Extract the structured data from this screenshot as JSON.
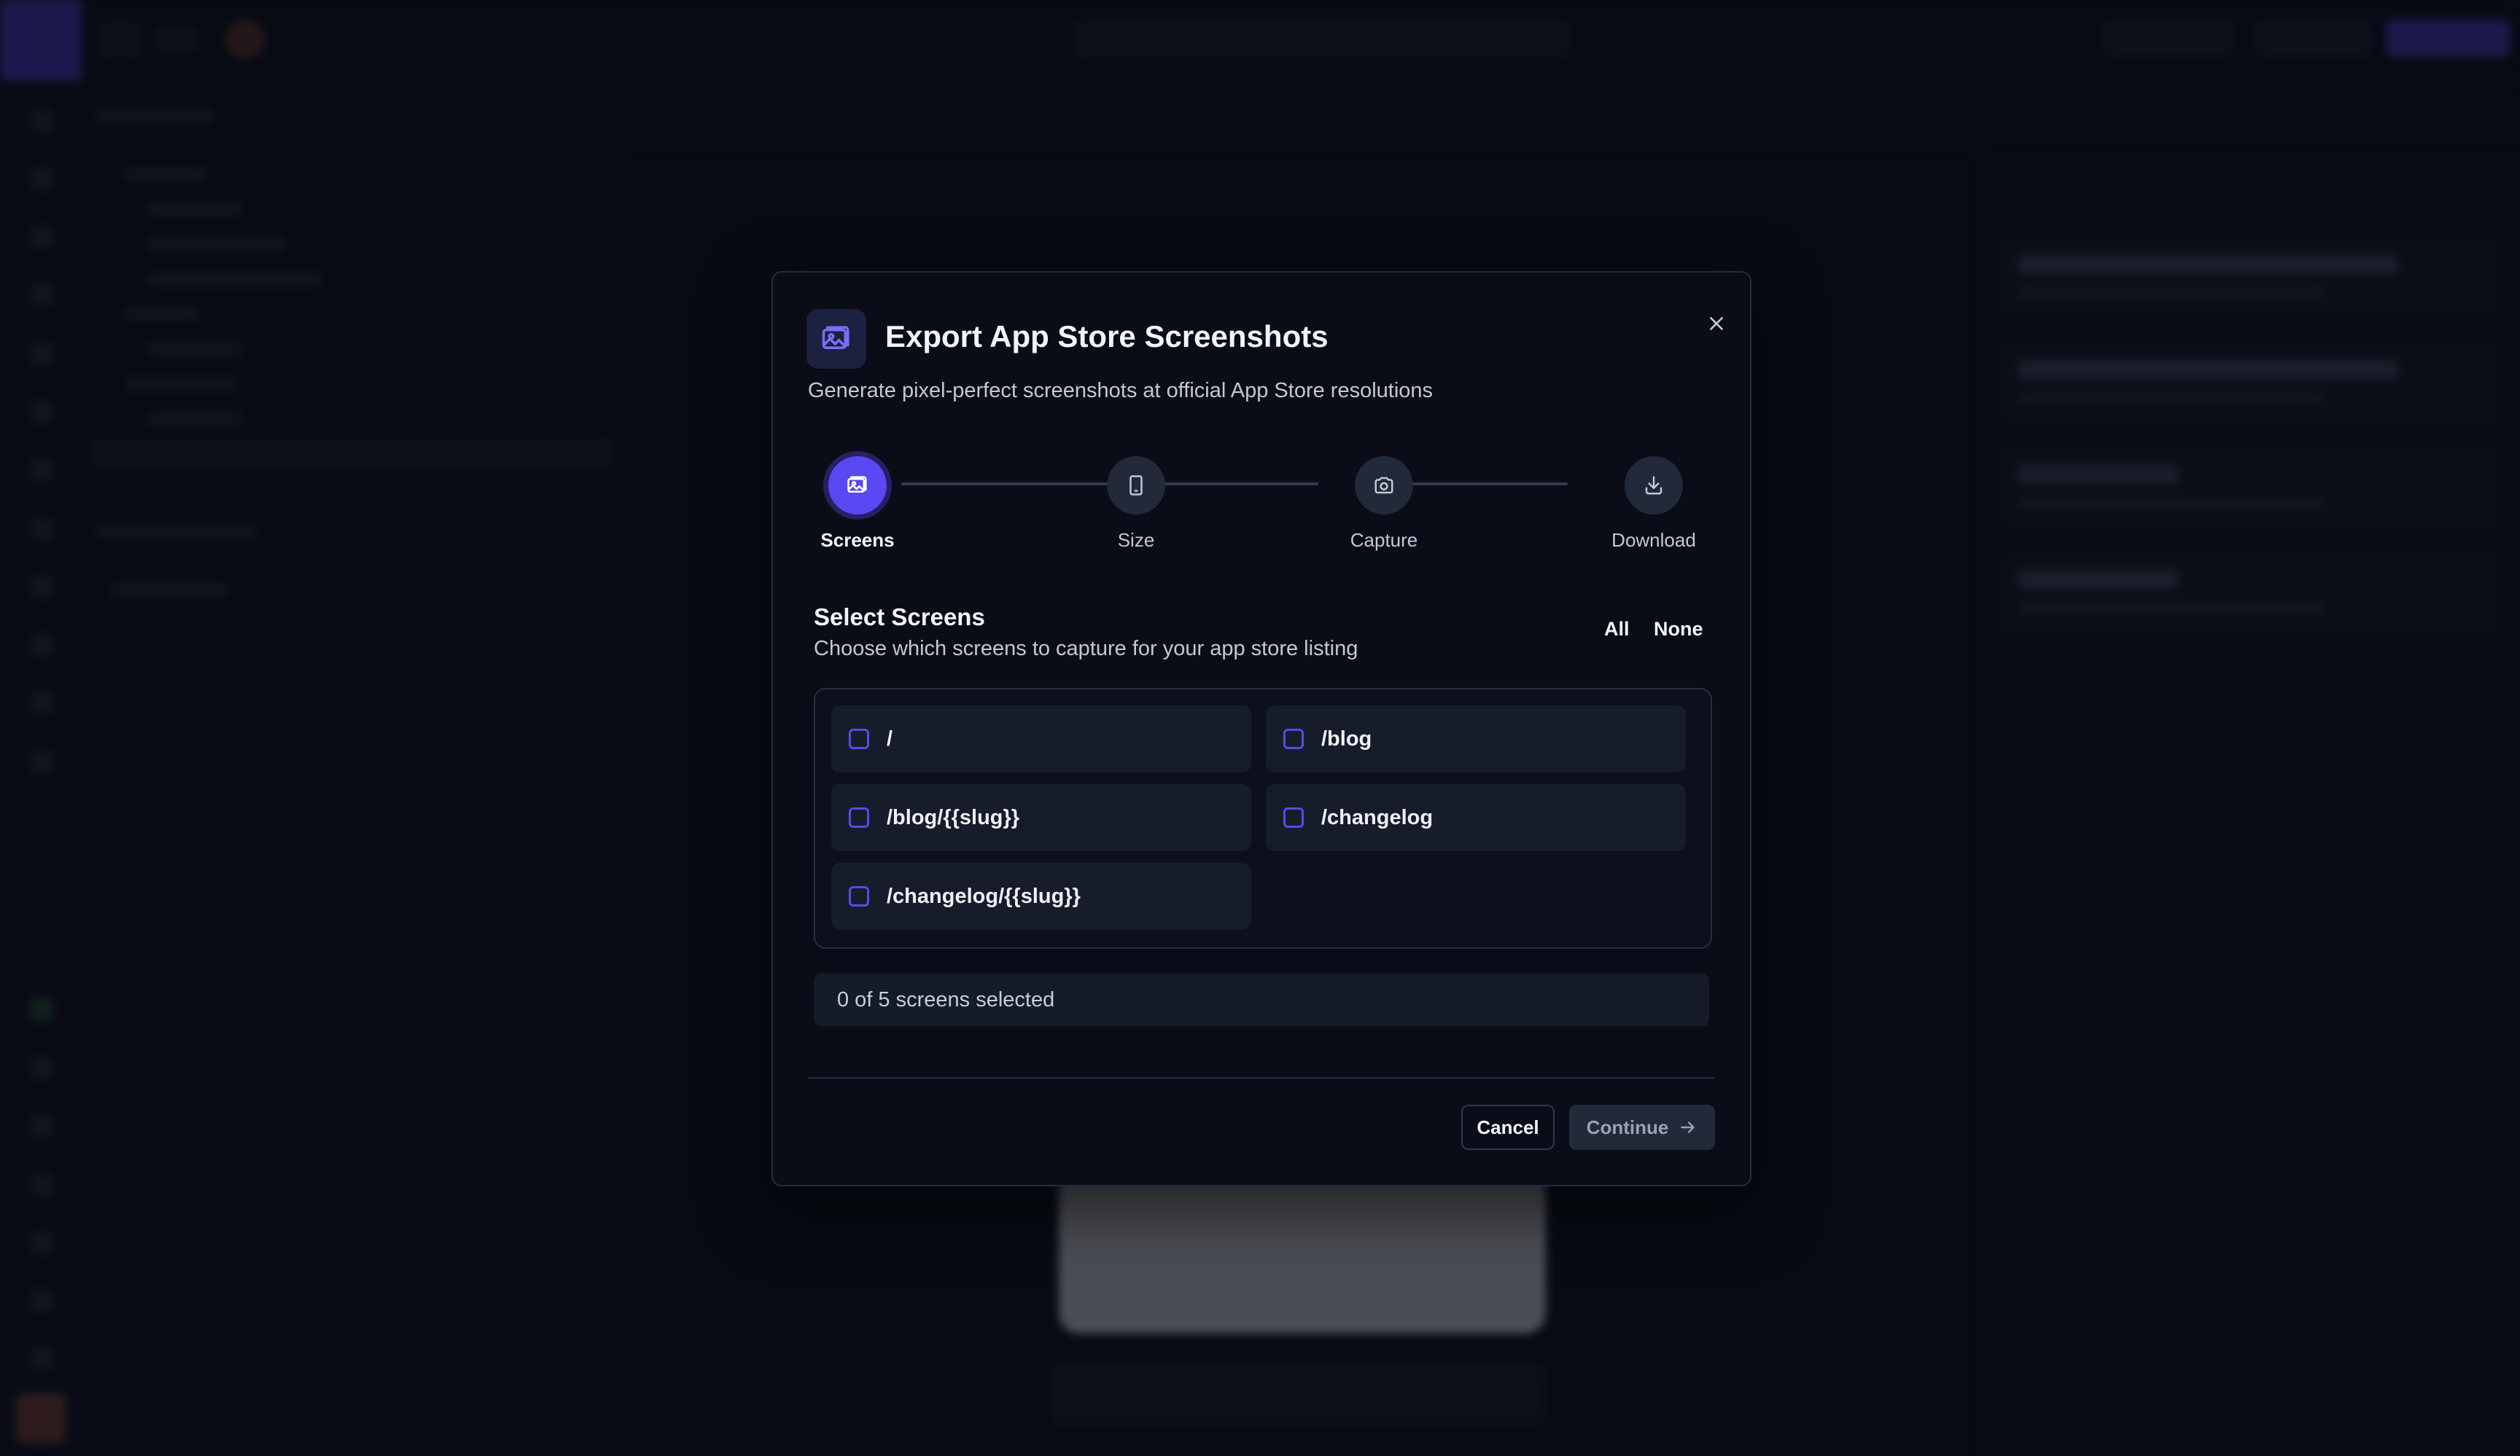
{
  "modal": {
    "title": "Export App Store Screenshots",
    "subtitle": "Generate pixel-perfect screenshots at official App Store resolutions",
    "header_icon": "image-icon",
    "close_icon": "close-icon"
  },
  "stepper": {
    "active_step": "Screens",
    "steps": [
      {
        "label": "Screens",
        "icon": "image-icon"
      },
      {
        "label": "Size",
        "icon": "phone-icon"
      },
      {
        "label": "Capture",
        "icon": "camera-icon"
      },
      {
        "label": "Download",
        "icon": "download-icon"
      }
    ]
  },
  "select_screens": {
    "title": "Select Screens",
    "description": "Choose which screens to capture for your app store listing",
    "all_label": "All",
    "none_label": "None",
    "screens": [
      {
        "label": "/",
        "checked": false
      },
      {
        "label": "/blog",
        "checked": false
      },
      {
        "label": "/blog/{{slug}}",
        "checked": false
      },
      {
        "label": "/changelog",
        "checked": false
      },
      {
        "label": "/changelog/{{slug}}",
        "checked": false
      }
    ],
    "selected_count_text": "0 of 5 screens selected"
  },
  "footer": {
    "cancel_label": "Cancel",
    "continue_label": "Continue",
    "continue_icon": "arrow-right-icon"
  },
  "colors": {
    "accent": "#5a48f2",
    "modal_bg": "#0a0d18",
    "page_bg": "#0b0f1a"
  }
}
